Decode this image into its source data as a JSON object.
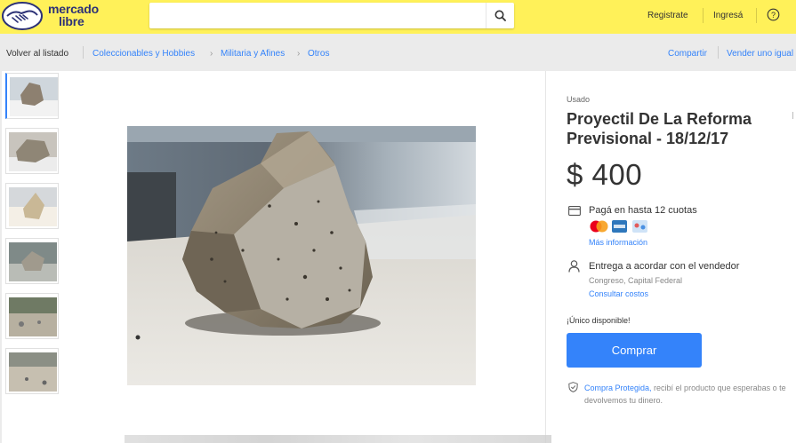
{
  "header": {
    "logo_line1": "mercado",
    "logo_line2": "libre",
    "search_value": "",
    "nav": {
      "register": "Registrate",
      "login": "Ingresá"
    }
  },
  "breadcrumb": {
    "back": "Volver al listado",
    "items": [
      "Coleccionables y Hobbies",
      "Militaria y Afines",
      "Otros"
    ],
    "share": "Compartir",
    "sell": "Vender uno igual"
  },
  "product": {
    "condition": "Usado",
    "title": "Proyectil De La Reforma Previsional - 18/12/17",
    "price": "$ 400",
    "payment": "Pagá en hasta 12 cuotas",
    "more_info": "Más información",
    "shipping": "Entrega a acordar con el vendedor",
    "location": "Congreso, Capital Federal",
    "shipping_costs": "Consultar costos",
    "stock": "¡Único disponible!",
    "buy_label": "Comprar",
    "protection_link": "Compra Protegida,",
    "protection_text": " recibí el producto que esperabas o te devolvemos tu dinero."
  },
  "icons": [
    "handshake-logo-icon",
    "search-icon",
    "help-icon",
    "card-icon",
    "user-icon",
    "shield-icon"
  ],
  "colors": {
    "header": "#fff159",
    "accent": "#3483fa",
    "logo_text": "#2d3277"
  }
}
